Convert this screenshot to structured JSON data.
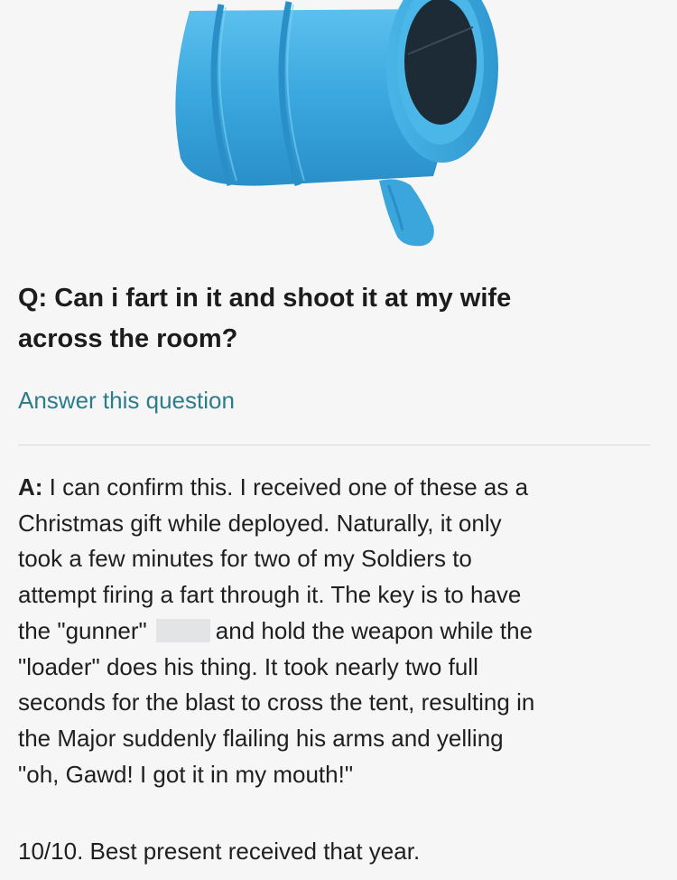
{
  "colors": {
    "background": "#f6f6f6",
    "link": "#2d7c8a",
    "toy_blue": "#3fa9dd",
    "divider": "#d9d9d9"
  },
  "image": {
    "subject": "blue air cannon toy"
  },
  "question": {
    "prefix": "Q:",
    "line1": "Can i fart in it and shoot it at my wife",
    "line2": "across the room?"
  },
  "answer_link": {
    "label": "Answer this question"
  },
  "answer": {
    "prefix": "A:",
    "line1": "I can confirm this. I received one of these as a",
    "line2": "Christmas gift while deployed. Naturally, it only",
    "line3": "took a few minutes for two of my Soldiers to",
    "line4": "attempt firing a fart through it. The key is to have",
    "line5a": "the \"gunner\"",
    "line5b": "and hold the weapon while the",
    "line6": "\"loader\" does his thing. It took nearly two full",
    "line7": "seconds for the blast to cross the tent, resulting in",
    "line8": "the Major suddenly flailing his arms and yelling",
    "line9": "\"oh, Gawd! I got it in my mouth!\""
  },
  "verdict": {
    "text": "10/10. Best present received that year."
  }
}
